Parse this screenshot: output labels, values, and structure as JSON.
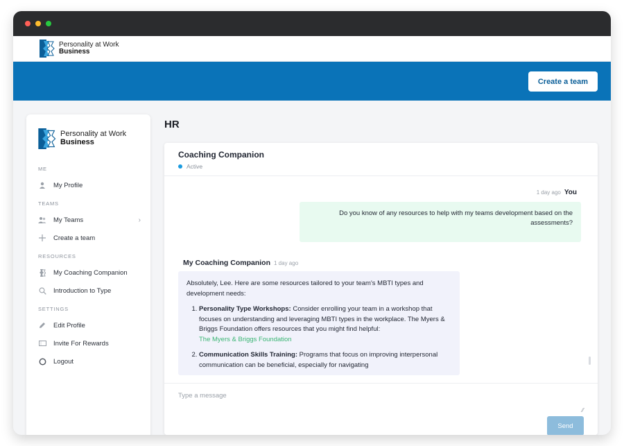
{
  "brand": {
    "name_line1": "Personality at Work",
    "name_line2": "Business",
    "colors": {
      "primary": "#0a73b8",
      "accent": "#3ab573",
      "active": "#1a9be0",
      "user_bubble": "#e8faf0",
      "bot_bubble": "#f1f2fb"
    }
  },
  "header": {
    "create_team_label": "Create a team"
  },
  "sidebar": {
    "sections": [
      {
        "label": "ME",
        "items": [
          {
            "label": "My Profile",
            "icon": "user-icon"
          }
        ]
      },
      {
        "label": "TEAMS",
        "items": [
          {
            "label": "My Teams",
            "icon": "team-icon",
            "has_chevron": true
          },
          {
            "label": "Create a team",
            "icon": "plus-icon"
          }
        ]
      },
      {
        "label": "RESOURCES",
        "items": [
          {
            "label": "My Coaching Companion",
            "icon": "companion-icon"
          },
          {
            "label": "Introduction to Type",
            "icon": "search-icon"
          }
        ]
      },
      {
        "label": "SETTINGS",
        "items": [
          {
            "label": "Edit Profile",
            "icon": "pencil-icon"
          },
          {
            "label": "Invite For Rewards",
            "icon": "ticket-icon"
          },
          {
            "label": "Logout",
            "icon": "logout-icon"
          }
        ]
      }
    ]
  },
  "page": {
    "title": "HR"
  },
  "chat": {
    "title": "Coaching Companion",
    "status": "Active",
    "user_message": {
      "time": "1 day ago",
      "sender": "You",
      "text": "Do you know of any resources to help with my teams development based on the assessments?"
    },
    "bot_message": {
      "sender": "My Coaching Companion",
      "time": "1 day ago",
      "intro": "Absolutely, Lee. Here are some resources tailored to your team's MBTI types and development needs:",
      "items": [
        {
          "title": "Personality Type Workshops:",
          "text": " Consider enrolling your team in a workshop that focuses on understanding and leveraging MBTI types in the workplace. The Myers & Briggs Foundation offers resources that you might find helpful:",
          "link": "The Myers & Briggs Foundation"
        },
        {
          "title": "Communication Skills Training:",
          "text": " Programs that focus on improving interpersonal communication can be beneficial, especially for navigating"
        }
      ]
    },
    "input_placeholder": "Type a message",
    "send_label": "Send"
  }
}
